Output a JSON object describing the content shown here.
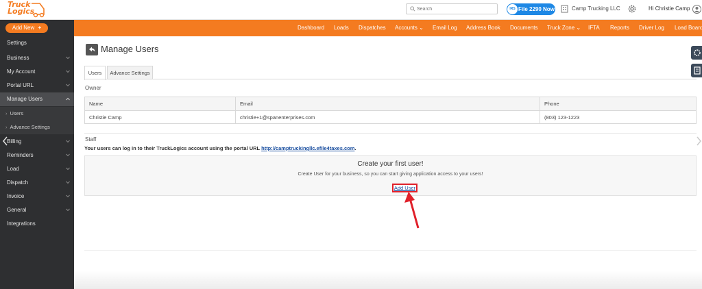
{
  "brand": {
    "logo_line1": "Truck",
    "logo_line2": "Logics"
  },
  "header": {
    "search_placeholder": "Search",
    "file_button": "File 2290 Now",
    "file_badge": "IRS",
    "company": "Camp Trucking LLC",
    "greeting": "Hi Christie Camp"
  },
  "sidebar": {
    "add_new": "Add New",
    "items": [
      {
        "label": "Settings"
      },
      {
        "label": "Business"
      },
      {
        "label": "My Account"
      },
      {
        "label": "Portal URL"
      },
      {
        "label": "Manage Users"
      },
      {
        "label": "Users"
      },
      {
        "label": "Advance Settings"
      },
      {
        "label": "Billing"
      },
      {
        "label": "Reminders"
      },
      {
        "label": "Load"
      },
      {
        "label": "Dispatch"
      },
      {
        "label": "Invoice"
      },
      {
        "label": "General"
      },
      {
        "label": "Integrations"
      }
    ]
  },
  "nav": {
    "items": [
      {
        "label": "Dashboard"
      },
      {
        "label": "Loads"
      },
      {
        "label": "Dispatches"
      },
      {
        "label": "Accounts"
      },
      {
        "label": "Email Log"
      },
      {
        "label": "Address Book"
      },
      {
        "label": "Documents"
      },
      {
        "label": "Truck Zone"
      },
      {
        "label": "IFTA"
      },
      {
        "label": "Reports"
      },
      {
        "label": "Driver Log"
      },
      {
        "label": "Load Board"
      }
    ]
  },
  "page": {
    "title": "Manage Users",
    "tabs": [
      {
        "label": "Users"
      },
      {
        "label": "Advance Settings"
      }
    ],
    "owner_label": "Owner",
    "owner_table": {
      "headers": [
        "Name",
        "Email",
        "Phone"
      ],
      "rows": [
        [
          "Christie Camp",
          "christie+1@spanenterprises.com",
          "(803) 123-1223"
        ]
      ]
    },
    "staff_label": "Staff",
    "portal_text": "Your users can log in to their TruckLogics account using the portal URL",
    "portal_url": "http://camptruckingllc.efile4taxes.com",
    "portal_suffix": ".",
    "create_title": "Create your first user!",
    "create_sub": "Create User for your business, so you can start giving application access to your users!",
    "add_user": "Add User"
  },
  "colors": {
    "accent": "#f47b20",
    "sidebar": "#2e2f31",
    "highlight": "#e0202a",
    "link": "#1a4fa0"
  }
}
